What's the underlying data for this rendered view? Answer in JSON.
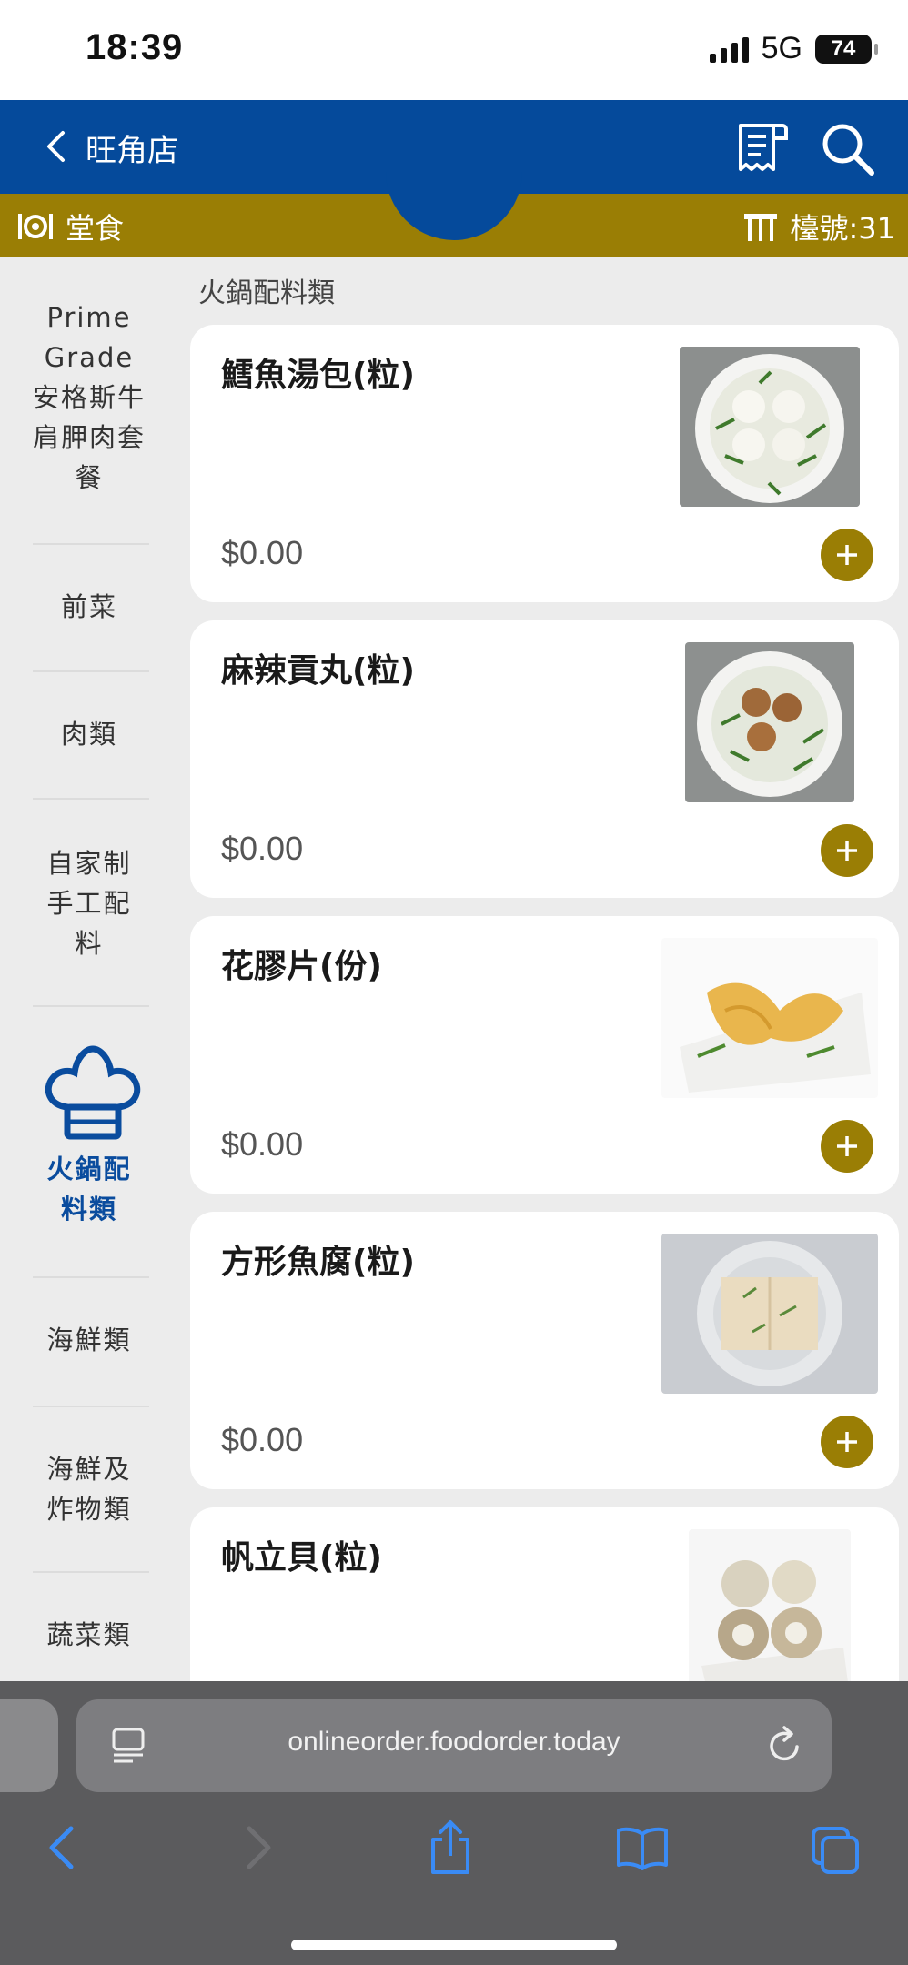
{
  "status": {
    "time": "18:39",
    "network": "5G",
    "battery": "74"
  },
  "header": {
    "title": "旺角店"
  },
  "modebar": {
    "mode": "堂食",
    "table": "檯號:31"
  },
  "sidebar": {
    "items": [
      {
        "label": "Prime Grade 安格斯牛肩胛肉套餐"
      },
      {
        "label": "前菜"
      },
      {
        "label": "肉類"
      },
      {
        "label": "自家制手工配料"
      },
      {
        "label": "火鍋配料類"
      },
      {
        "label": "海鮮類"
      },
      {
        "label": "海鮮及炸物類"
      },
      {
        "label": "蔬菜類"
      }
    ],
    "active_index": 4
  },
  "content": {
    "section_title": "火鍋配料類",
    "items": [
      {
        "name": "鱈魚湯包(粒)",
        "price": "$0.00"
      },
      {
        "name": "麻辣貢丸(粒)",
        "price": "$0.00"
      },
      {
        "name": "花膠片(份)",
        "price": "$0.00"
      },
      {
        "name": "方形魚腐(粒)",
        "price": "$0.00"
      },
      {
        "name": "帆立貝(粒)",
        "price": ""
      }
    ]
  },
  "browser": {
    "url": "onlineorder.foodorder.today"
  },
  "colors": {
    "header_blue": "#054a9b",
    "gold": "#9a7e05",
    "active_blue": "#0a4c9e"
  }
}
